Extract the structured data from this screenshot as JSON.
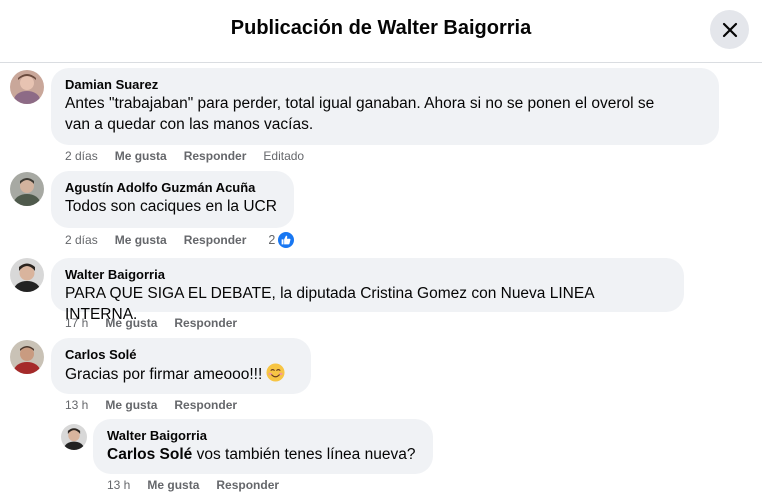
{
  "header": {
    "title": "Publicación de Walter Baigorria"
  },
  "comments": [
    {
      "author": "Damian Suarez",
      "text_line1": "Antes \"trabajaban\" para perder, total igual ganaban. Ahora si no se ponen el overol se",
      "text_line2": "van a quedar con las manos vacías.",
      "time": "2 días",
      "like": "Me gusta",
      "reply": "Responder",
      "edited": "Editado"
    },
    {
      "author": "Agustín Adolfo Guzmán Acuña",
      "text": "Todos son caciques en la UCR",
      "time": "2 días",
      "like": "Me gusta",
      "reply": "Responder",
      "reaction_count": "2"
    },
    {
      "author": "Walter Baigorria",
      "text": "PARA QUE SIGA EL DEBATE, la diputada Cristina Gomez con Nueva LINEA INTERNA.",
      "time": "17 h",
      "like": "Me gusta",
      "reply": "Responder"
    },
    {
      "author": "Carlos Solé",
      "text": "Gracias por firmar ameooo!!!",
      "time": "13 h",
      "like": "Me gusta",
      "reply": "Responder",
      "emoji": "smiling-face-icon"
    },
    {
      "author": "Walter Baigorria",
      "mention": "Carlos Solé",
      "text": " vos también tenes línea nueva?",
      "time": "13 h",
      "like": "Me gusta",
      "reply": "Responder"
    }
  ],
  "colors": {
    "bubble": "#f0f2f5",
    "meta": "#65676b",
    "like_blue": "#1877f2"
  }
}
